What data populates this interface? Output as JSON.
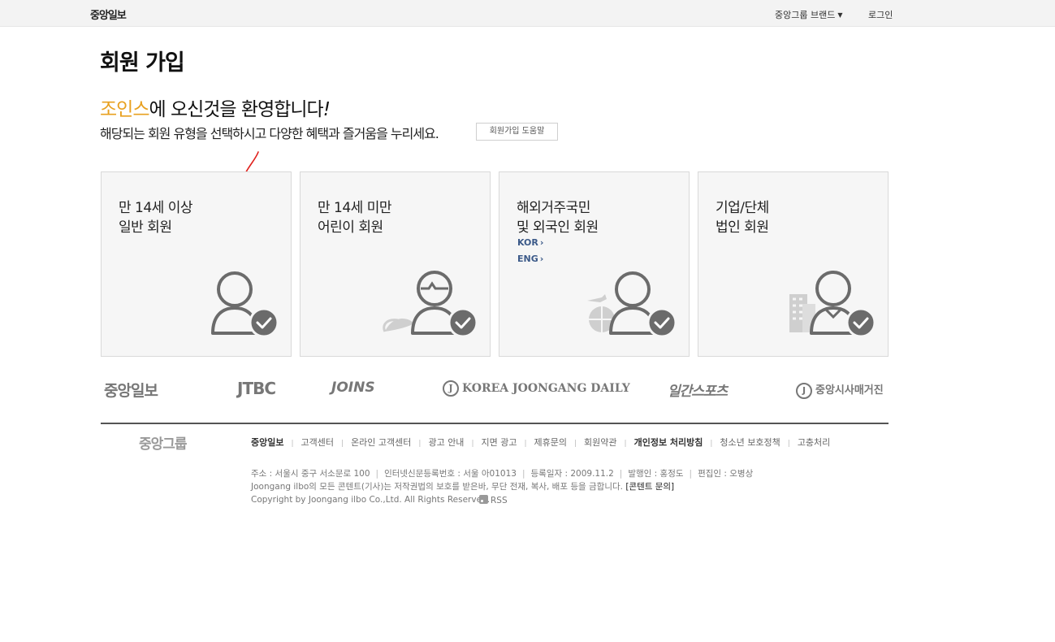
{
  "topbar": {
    "logo": "중앙일보",
    "brand_menu": "중앙그룹 브랜드",
    "login": "로그인"
  },
  "page_title": "회원 가입",
  "welcome": {
    "brand": "조인스",
    "text": "에 오신것을 환영합니다",
    "excl": "!"
  },
  "subtitle": "해당되는 회원 유형을 선택하시고 다양한 혜택과 즐거움을 누리세요.",
  "help_button": "회원가입 도움말",
  "cards": [
    {
      "line1": "만 14세 이상",
      "line2": "일반 회원",
      "icon": "adult-member-icon"
    },
    {
      "line1": "만 14세 미만",
      "line2": "어린이 회원",
      "icon": "child-member-icon"
    },
    {
      "line1": "해외거주국민",
      "line2": "및 외국인 회원",
      "icon": "overseas-member-icon",
      "links": [
        "KOR",
        "ENG"
      ]
    },
    {
      "line1": "기업/단체",
      "line2": "법인 회원",
      "icon": "corporate-member-icon"
    }
  ],
  "brands": {
    "joongang": "중앙일보",
    "jtbc": "JTBC",
    "joins": "JOINS",
    "kjd": "KOREA JOONGANG DAILY",
    "ilgan": "일간스포츠",
    "sisa": "중앙시사매거진",
    "j_letter": "J"
  },
  "footer": {
    "group_logo": "중앙그룹",
    "links": [
      "중앙일보",
      "고객센터",
      "온라인 고객센터",
      "광고 안내",
      "지면 광고",
      "제휴문의",
      "회원약관",
      "개인정보 처리방침",
      "청소년 보호정책",
      "고충처리"
    ],
    "address": [
      "주소 : 서울시 중구 서소문로 100",
      "인터넷신문등록번호 : 서울 아01013",
      "등록일자 : 2009.11.2",
      "발행인 : 홍정도",
      "편집인 : 오병상"
    ],
    "notice": "Joongang ilbo의 모든 콘텐트(기사)는 저작권법의 보호를 받은바, 무단 전재, 복사, 배포 등을 금합니다.",
    "notice_link": "[콘텐트 문의]",
    "copyright": "Copyright by Joongang ilbo Co.,Ltd. All Rights Reserved.",
    "rss": "RSS"
  },
  "colors": {
    "brand_highlight": "#e8a01f",
    "lang_link": "#3c5a89",
    "annotation": "#e0201c",
    "icon_gray": "#6b6b6b"
  }
}
